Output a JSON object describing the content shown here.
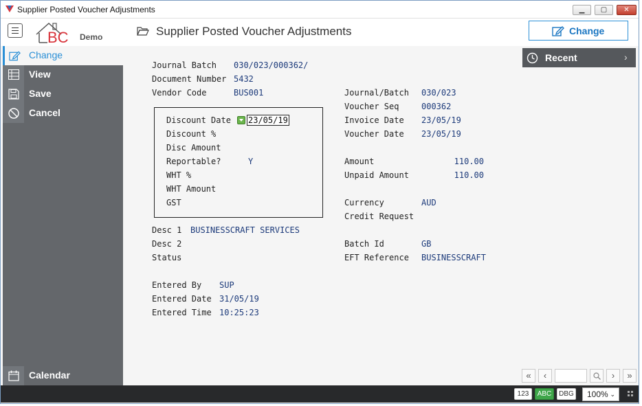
{
  "window": {
    "title": "Supplier Posted Voucher Adjustments"
  },
  "header": {
    "logo_demo": "Demo",
    "page_title": "Supplier Posted Voucher Adjustments",
    "change_button": "Change"
  },
  "sidebar": {
    "items": [
      {
        "label": "Change",
        "icon": "pencil-icon",
        "active": true
      },
      {
        "label": "View",
        "icon": "table-icon"
      },
      {
        "label": "Save",
        "icon": "floppy-disk-icon"
      },
      {
        "label": "Cancel",
        "icon": "cancel-icon"
      }
    ],
    "calendar": "Calendar"
  },
  "recent": {
    "label": "Recent"
  },
  "form": {
    "journal_batch": {
      "label": "Journal Batch",
      "value": "030/023/000362/"
    },
    "document_number": {
      "label": "Document Number",
      "value": "5432"
    },
    "vendor_code": {
      "label": "Vendor Code",
      "value": "BUS001"
    },
    "discount": {
      "discount_date": {
        "label": "Discount Date",
        "value": "23/05/19"
      },
      "discount_pct": {
        "label": "Discount %"
      },
      "disc_amount": {
        "label": "Disc Amount"
      },
      "reportable": {
        "label": "Reportable?",
        "value": "Y"
      },
      "wht_pct": {
        "label": "WHT %"
      },
      "wht_amount": {
        "label": "WHT Amount"
      },
      "gst": {
        "label": "GST"
      }
    },
    "desc1": {
      "label": "Desc 1",
      "value": "BUSINESSCRAFT SERVICES"
    },
    "desc2": {
      "label": "Desc 2"
    },
    "status": {
      "label": "Status"
    },
    "entered_by": {
      "label": "Entered By",
      "value": "SUP"
    },
    "entered_date": {
      "label": "Entered Date",
      "value": "31/05/19"
    },
    "entered_time": {
      "label": "Entered Time",
      "value": "10:25:23"
    },
    "right": {
      "journal_batch": {
        "label": "Journal/Batch",
        "value": "030/023"
      },
      "voucher_seq": {
        "label": "Voucher Seq",
        "value": "000362"
      },
      "invoice_date": {
        "label": "Invoice Date",
        "value": "23/05/19"
      },
      "voucher_date": {
        "label": "Voucher Date",
        "value": "23/05/19"
      },
      "amount": {
        "label": "Amount",
        "value": "110.00"
      },
      "unpaid_amount": {
        "label": "Unpaid Amount",
        "value": "110.00"
      },
      "currency": {
        "label": "Currency",
        "value": "AUD"
      },
      "credit_request": {
        "label": "Credit Request"
      },
      "batch_id": {
        "label": "Batch Id",
        "value": "GB"
      },
      "eft_reference": {
        "label": "EFT Reference",
        "value": "BUSINESSCRAFT"
      }
    }
  },
  "statusbar": {
    "num_tag": "123",
    "abc_tag": "ABC",
    "dbg_tag": "DBG",
    "zoom": "100%"
  },
  "colors": {
    "accent": "#2a8fd6",
    "sidebar": "#64676b",
    "value_text": "#1c3a7a",
    "abc_green": "#3fa64a"
  }
}
